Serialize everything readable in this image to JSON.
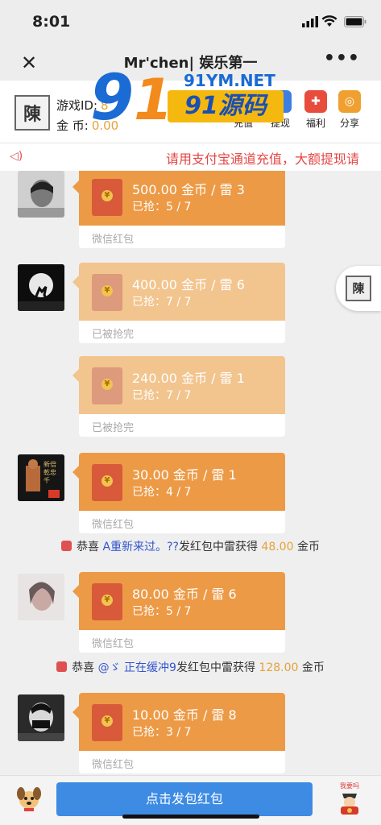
{
  "status_bar": {
    "time": "8:01"
  },
  "nav": {
    "close_icon": "close-icon",
    "title": "Mr'chen| 娱乐第一",
    "more_icon": "more-icon"
  },
  "header": {
    "logo_text": "陳",
    "game_id_label": "游戏ID:",
    "game_id_value": "8",
    "gold_label": "金  币:",
    "gold_value": "0.00",
    "actions": [
      {
        "label": "充值",
        "icon": "recharge-icon",
        "color": "#3d7fe0"
      },
      {
        "label": "提现",
        "icon": "withdraw-icon",
        "color": "#3d7fe0"
      },
      {
        "label": "福利",
        "icon": "gift-icon",
        "color": "#e74c3c"
      },
      {
        "label": "分享",
        "icon": "share-icon",
        "color": "#f0a030"
      }
    ]
  },
  "watermark": {
    "domain": "91YM.NET",
    "brand": "91源码"
  },
  "notice": {
    "text": "请用支付宝通道充值，大额提现请"
  },
  "packets": [
    {
      "amount": "500.00 金币 / 雷 3",
      "grabbed": "已抢：5 / 7",
      "footer": "微信红包",
      "state": "active"
    },
    {
      "amount": "400.00 金币 / 雷 6",
      "grabbed": "已抢：7 / 7",
      "footer": "已被抢完",
      "state": "done"
    },
    {
      "amount": "240.00 金币 / 雷 1",
      "grabbed": "已抢：7 / 7",
      "footer": "已被抢完",
      "state": "done"
    },
    {
      "amount": "30.00 金币 / 雷 1",
      "grabbed": "已抢：4 / 7",
      "footer": "微信红包",
      "state": "active"
    },
    {
      "amount": "80.00 金币 / 雷 6",
      "grabbed": "已抢：5 / 7",
      "footer": "微信红包",
      "state": "active"
    },
    {
      "amount": "10.00 金币 / 雷 8",
      "grabbed": "已抢：3 / 7",
      "footer": "微信红包",
      "state": "active"
    }
  ],
  "system_messages": [
    {
      "prefix": "恭喜",
      "name": "A重新来过。??",
      "middle": "发红包中雷获得",
      "amount": "48.00",
      "unit": "金币"
    },
    {
      "prefix": "恭喜",
      "name": "@ゞ 正在缓冲9",
      "middle": "发红包中雷获得",
      "amount": "128.00",
      "unit": "金币"
    }
  ],
  "avatar4_text": "新倍 乾忠千",
  "float_button_text": "陳",
  "bottom": {
    "send_label": "点击发包红包",
    "right_icon_text": "我要吗"
  },
  "colors": {
    "packet_active": "#ec9a46",
    "packet_done": "#f2c48e",
    "send_button": "#3d8be3",
    "notice_text": "#e64545"
  }
}
